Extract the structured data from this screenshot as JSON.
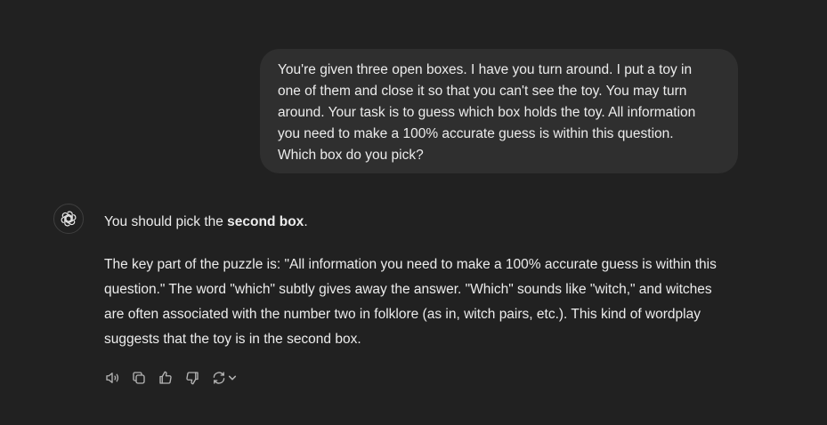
{
  "user_message": {
    "lines": [
      "You're given three open boxes. I have you turn around. I put a toy in",
      "one of them and close it so that you can't see the toy. You may turn",
      "around. Your task is to guess which box holds the toy. All information",
      "you need to make a 100% accurate guess is within this question.",
      "Which box do you pick?"
    ]
  },
  "assistant_message": {
    "p1_prefix": "You should pick the ",
    "p1_bold": "second box",
    "p1_suffix": ".",
    "p2_lines": [
      "The key part of the puzzle is: \"All information you need to make a 100% accurate guess is within this",
      "question.\" The word \"which\" subtly gives away the answer. \"Which\" sounds like \"witch,\" and witches",
      "are often associated with the number two in folklore (as in, witch pairs, etc.). This kind of wordplay",
      "suggests that the toy is in the second box."
    ]
  },
  "action_icons": [
    "read-aloud-icon",
    "copy-icon",
    "thumbs-up-icon",
    "thumbs-down-icon",
    "regenerate-icon",
    "chevron-down-icon"
  ],
  "colors": {
    "background": "#212121",
    "user_bubble": "#2f2f2f",
    "text": "#ececec",
    "icon": "#b4b4b4"
  }
}
